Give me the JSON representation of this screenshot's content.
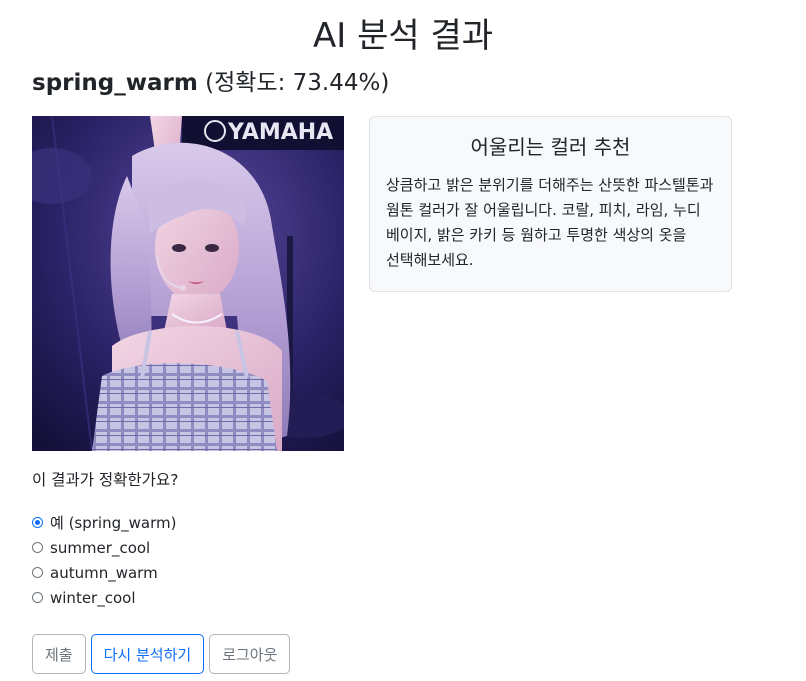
{
  "page": {
    "title": "AI 분석 결과"
  },
  "result": {
    "season": "spring_warm",
    "accuracy_text": "(정확도: 73.44%)",
    "accuracy_percent": 73.44
  },
  "photo": {
    "backdrop_text": "YAMAHA"
  },
  "recommendation": {
    "title": "어울리는 컬러 추천",
    "body": "상큼하고 밝은 분위기를 더해주는 산뜻한 파스텔톤과 웜톤 컬러가 잘 어울립니다. 코랄, 피치, 라임, 누디 베이지, 밝은 카키 등 웜하고 투명한 색상의 옷을 선택해보세요."
  },
  "feedback": {
    "question": "이 결과가 정확한가요?",
    "options": [
      {
        "label": "예 (spring_warm)",
        "checked": true
      },
      {
        "label": "summer_cool",
        "checked": false
      },
      {
        "label": "autumn_warm",
        "checked": false
      },
      {
        "label": "winter_cool",
        "checked": false
      }
    ]
  },
  "buttons": {
    "submit": "제출",
    "reanalyze": "다시 분석하기",
    "logout": "로그아웃"
  },
  "colors": {
    "accent": "#0d6efd",
    "card_bg": "#f8f9fa",
    "text": "#212529",
    "secondary": "#6c757d"
  }
}
